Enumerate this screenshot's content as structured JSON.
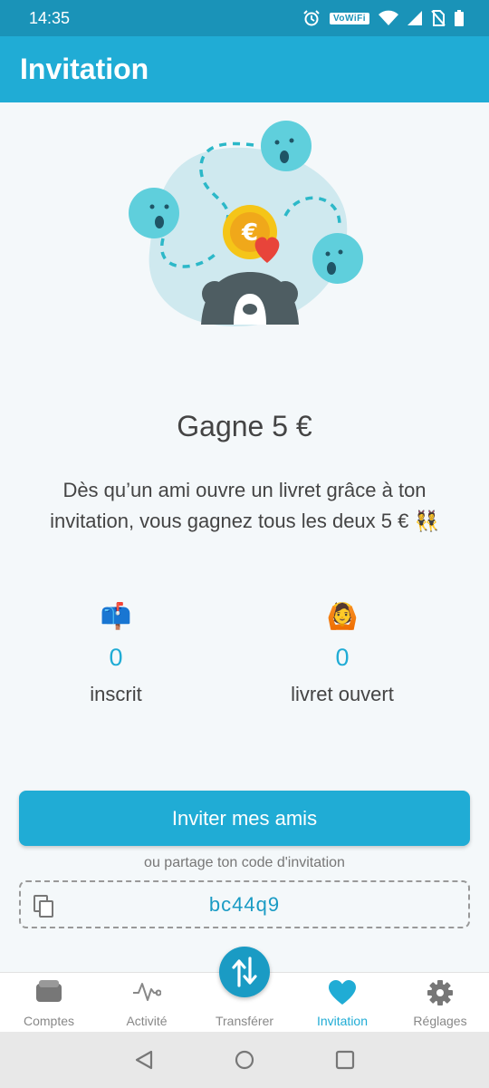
{
  "status_bar": {
    "time": "14:35",
    "vowifi_label": "VoWiFi",
    "icons": [
      "alarm-icon",
      "vowifi-icon",
      "wifi-icon",
      "signal-icon",
      "no-sim-icon",
      "battery-icon"
    ]
  },
  "app_bar": {
    "title": "Invitation"
  },
  "hero": {
    "coin_symbol": "€"
  },
  "content": {
    "title": "Gagne 5 €",
    "description": "Dès qu’un ami ouvre un livret grâce à ton invitation, vous gagnez tous les deux 5 € 👯"
  },
  "stats": [
    {
      "emoji": "📫",
      "value": "0",
      "label": "inscrit"
    },
    {
      "emoji": "🙆",
      "value": "0",
      "label": "livret ouvert"
    }
  ],
  "invite_button": {
    "label": "Inviter mes amis"
  },
  "share_hint": "ou partage ton code d'invitation",
  "invite_code": "bc44q9",
  "bottom_nav": {
    "items": [
      {
        "label": "Comptes",
        "icon": "wallet-icon"
      },
      {
        "label": "Activité",
        "icon": "activity-icon"
      },
      {
        "label": "Transférer",
        "icon": "transfer-icon"
      },
      {
        "label": "Invitation",
        "icon": "heart-icon",
        "active": true
      },
      {
        "label": "Réglages",
        "icon": "gear-icon"
      }
    ]
  },
  "colors": {
    "primary": "#20acd5",
    "status_bar": "#1a93b8",
    "background": "#f4f8fa"
  }
}
